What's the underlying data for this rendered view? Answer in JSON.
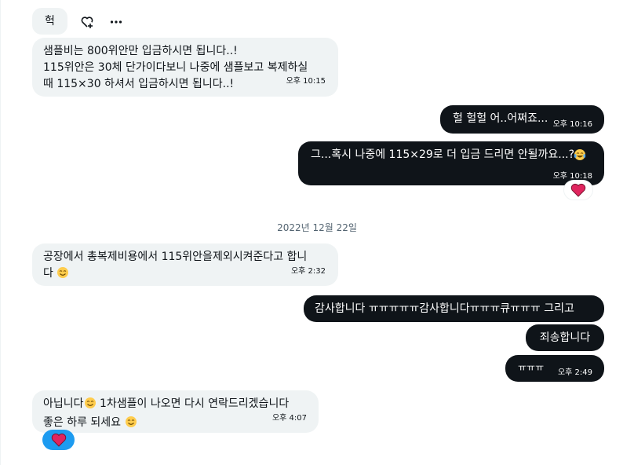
{
  "messages": {
    "m0": {
      "text": "헉"
    },
    "m1": {
      "line1": "샘플비는 800위안만 입금하시면 됩니다..!",
      "line2": "115위안은 30체 단가이다보니 나중에 샘플보고 복제하실",
      "line3": "때 115×30 하셔서 입금하시면 됩니다..!",
      "time": "오후 10:15"
    },
    "m2": {
      "text": "헐 헐헐 어..어쩌죠...",
      "time": "오후 10:16"
    },
    "m3": {
      "text": "그...혹시 나중에 115×29로 더 입금 드리면 안될까요...?",
      "time": "오후 10:18",
      "reaction": "heart"
    },
    "m4": {
      "line1": "공장에서 총복제비용에서 115위안을제외시켜준다고 합니",
      "line2": "다",
      "time": "오후 2:32"
    },
    "m5": {
      "text": "감사합니다 ㅠㅠㅠㅠㅠ감사합니다ㅠㅠㅠ큐ㅠㅠㅠ 그리고"
    },
    "m6": {
      "text": "죄송합니다"
    },
    "m7": {
      "text": "ㅠㅠㅠ",
      "time": "오후 2:49"
    },
    "m8": {
      "line1_a": "아닙니다",
      "line1_b": "1차샘플이 나오면 다시 연락드리겠습니다",
      "line2": "좋은 하루 되세요",
      "time": "오후 4:07",
      "reaction": "heart"
    }
  },
  "date_separator": "2022년 12월 22일",
  "icons": {
    "add_reaction": "add-reaction-icon",
    "more": "more-icon",
    "heart": "heart-emoji",
    "smile": "smiling-face-emoji",
    "laugh": "tears-of-joy-emoji"
  },
  "colors": {
    "incoming_bubble": "#eff3f4",
    "outgoing_bubble": "#0f1419",
    "my_reaction_pill": "#1d9bf0",
    "heart": "#e0245e"
  }
}
